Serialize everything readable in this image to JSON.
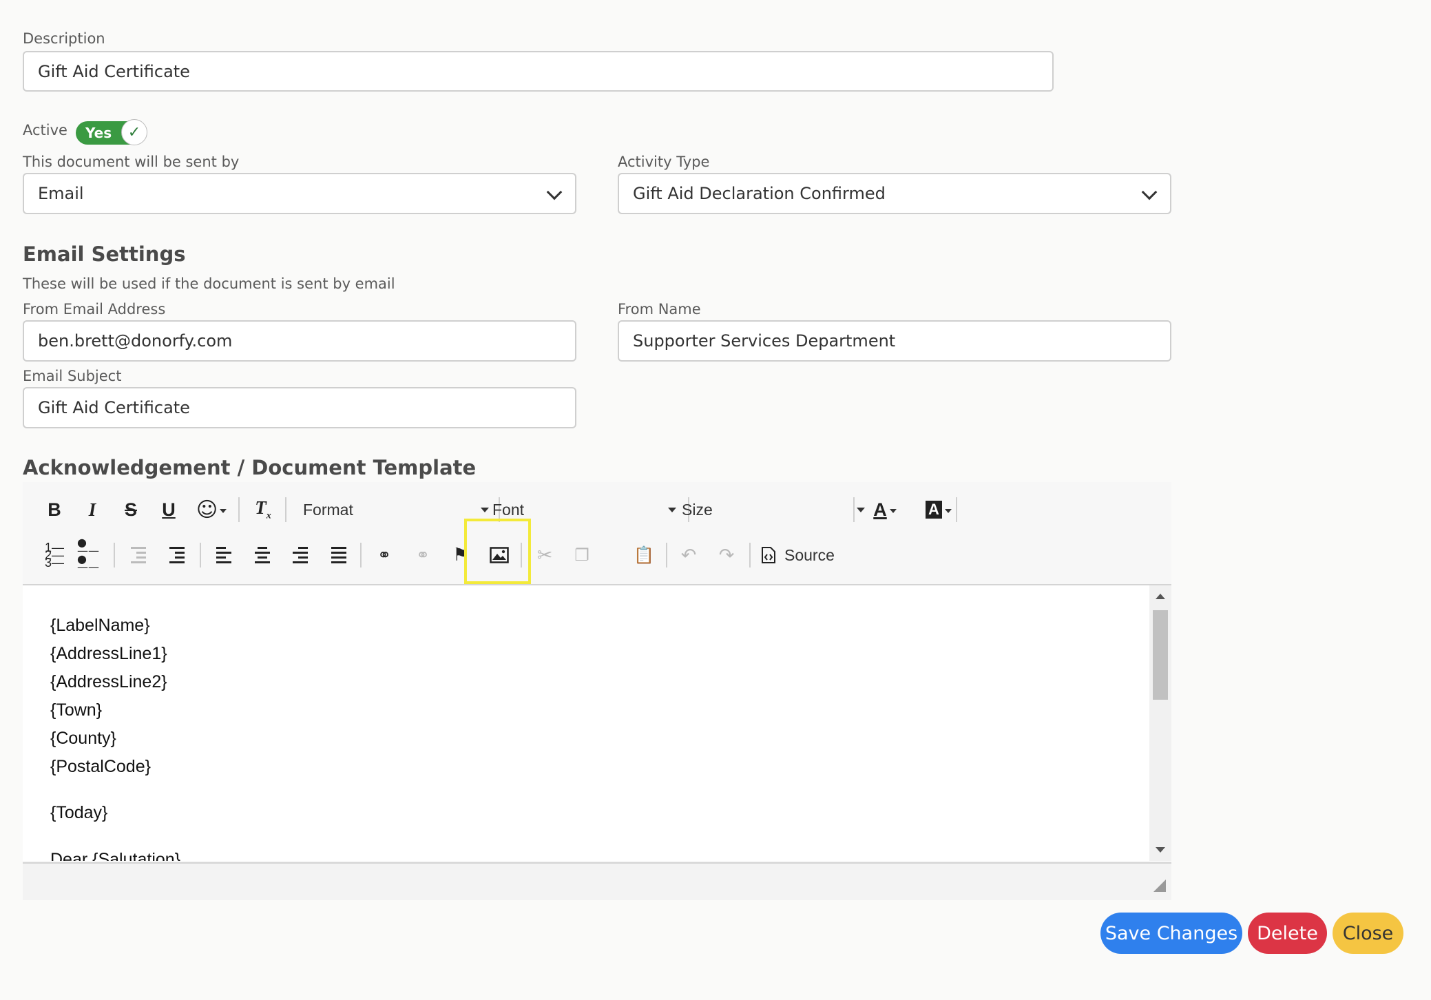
{
  "description": {
    "label": "Description",
    "value": "Gift Aid Certificate"
  },
  "active": {
    "label": "Active",
    "toggle_text": "Yes",
    "check_icon": "check-icon",
    "color": "#3a9a42"
  },
  "sent_by": {
    "label": "This document will be sent by",
    "value": "Email"
  },
  "activity_type": {
    "label": "Activity Type",
    "value": "Gift Aid Declaration Confirmed"
  },
  "email_settings": {
    "title": "Email Settings",
    "subtitle": "These will be used if the document is sent by email",
    "from_email": {
      "label": "From Email Address",
      "value": "ben.brett@donorfy.com"
    },
    "from_name": {
      "label": "From Name",
      "value": "Supporter Services Department"
    },
    "subject": {
      "label": "Email Subject",
      "value": "Gift Aid Certificate"
    }
  },
  "template": {
    "title": "Acknowledgement / Document Template",
    "toolbar": {
      "bold": "B",
      "italic": "I",
      "strike": "S",
      "underline": "U",
      "emoji_icon": "smiley-icon",
      "remove_format": "Tx",
      "format_label": "Format",
      "font_label": "Font",
      "size_label": "Size",
      "text_color": "A",
      "bg_color": "A",
      "source_label": "Source",
      "icons": [
        "numbered-list-icon",
        "bulleted-list-icon",
        "outdent-icon",
        "indent-icon",
        "align-left-icon",
        "align-center-icon",
        "align-right-icon",
        "justify-icon",
        "link-icon",
        "unlink-icon",
        "anchor-icon",
        "image-icon",
        "cut-icon",
        "copy-icon",
        "paste-icon",
        "undo-icon",
        "redo-icon",
        "source-icon"
      ]
    },
    "content_lines": [
      "{LabelName}",
      "{AddressLine1}",
      "{AddressLine2}",
      "{Town}",
      "{County}",
      "{PostalCode}",
      "{Today}",
      "Dear {Salutation}"
    ]
  },
  "actions": {
    "save": "Save Changes",
    "delete": "Delete",
    "close": "Close",
    "colors": {
      "save": "#2f80ed",
      "delete": "#dc3545",
      "close": "#f5c542"
    }
  }
}
